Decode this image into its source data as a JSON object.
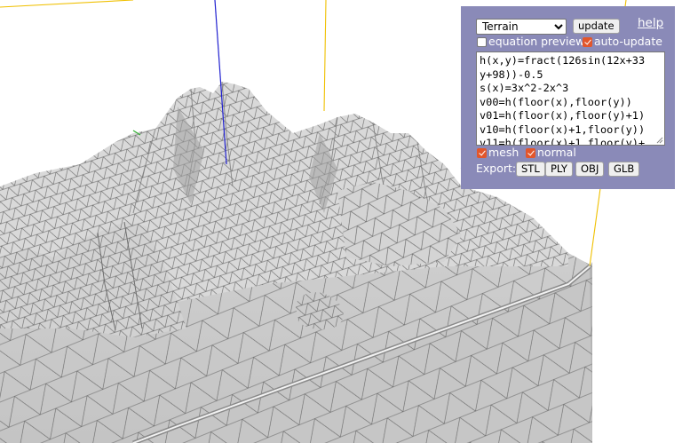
{
  "panel": {
    "preset_select": {
      "value": "Terrain",
      "options": [
        "Terrain"
      ]
    },
    "update_label": "update",
    "help_label": "help",
    "equation_preview": {
      "label": "equation preview",
      "checked": false
    },
    "auto_update": {
      "label": "auto-update",
      "checked": true
    },
    "equation_lines": [
      "h(x,y)=fract(126sin(12x+33",
      "y+98))-0.5",
      "s(x)=3x^2-2x^3",
      "v00=h(floor(x),floor(y))",
      "v01=h(floor(x),floor(y)+1)",
      "v10=h(floor(x)+1,floor(y))",
      "v11=h(floor(x)+1,floor(y)+"
    ],
    "mesh": {
      "label": "mesh",
      "checked": true
    },
    "normal": {
      "label": "normal",
      "checked": true
    },
    "export_label": "Export:",
    "export_buttons": [
      "STL",
      "PLY",
      "OBJ",
      "GLB"
    ]
  },
  "colors": {
    "panel_bg": "#8a8ab8",
    "checkbox_on": "#e2562b",
    "mesh_fill": "#d7d7d7",
    "wire": "#4a4a4a",
    "axis_z": "#2020d0",
    "axis_x": "#c01890",
    "axis_y": "#30b030",
    "bounding_box": "#f0c000"
  }
}
